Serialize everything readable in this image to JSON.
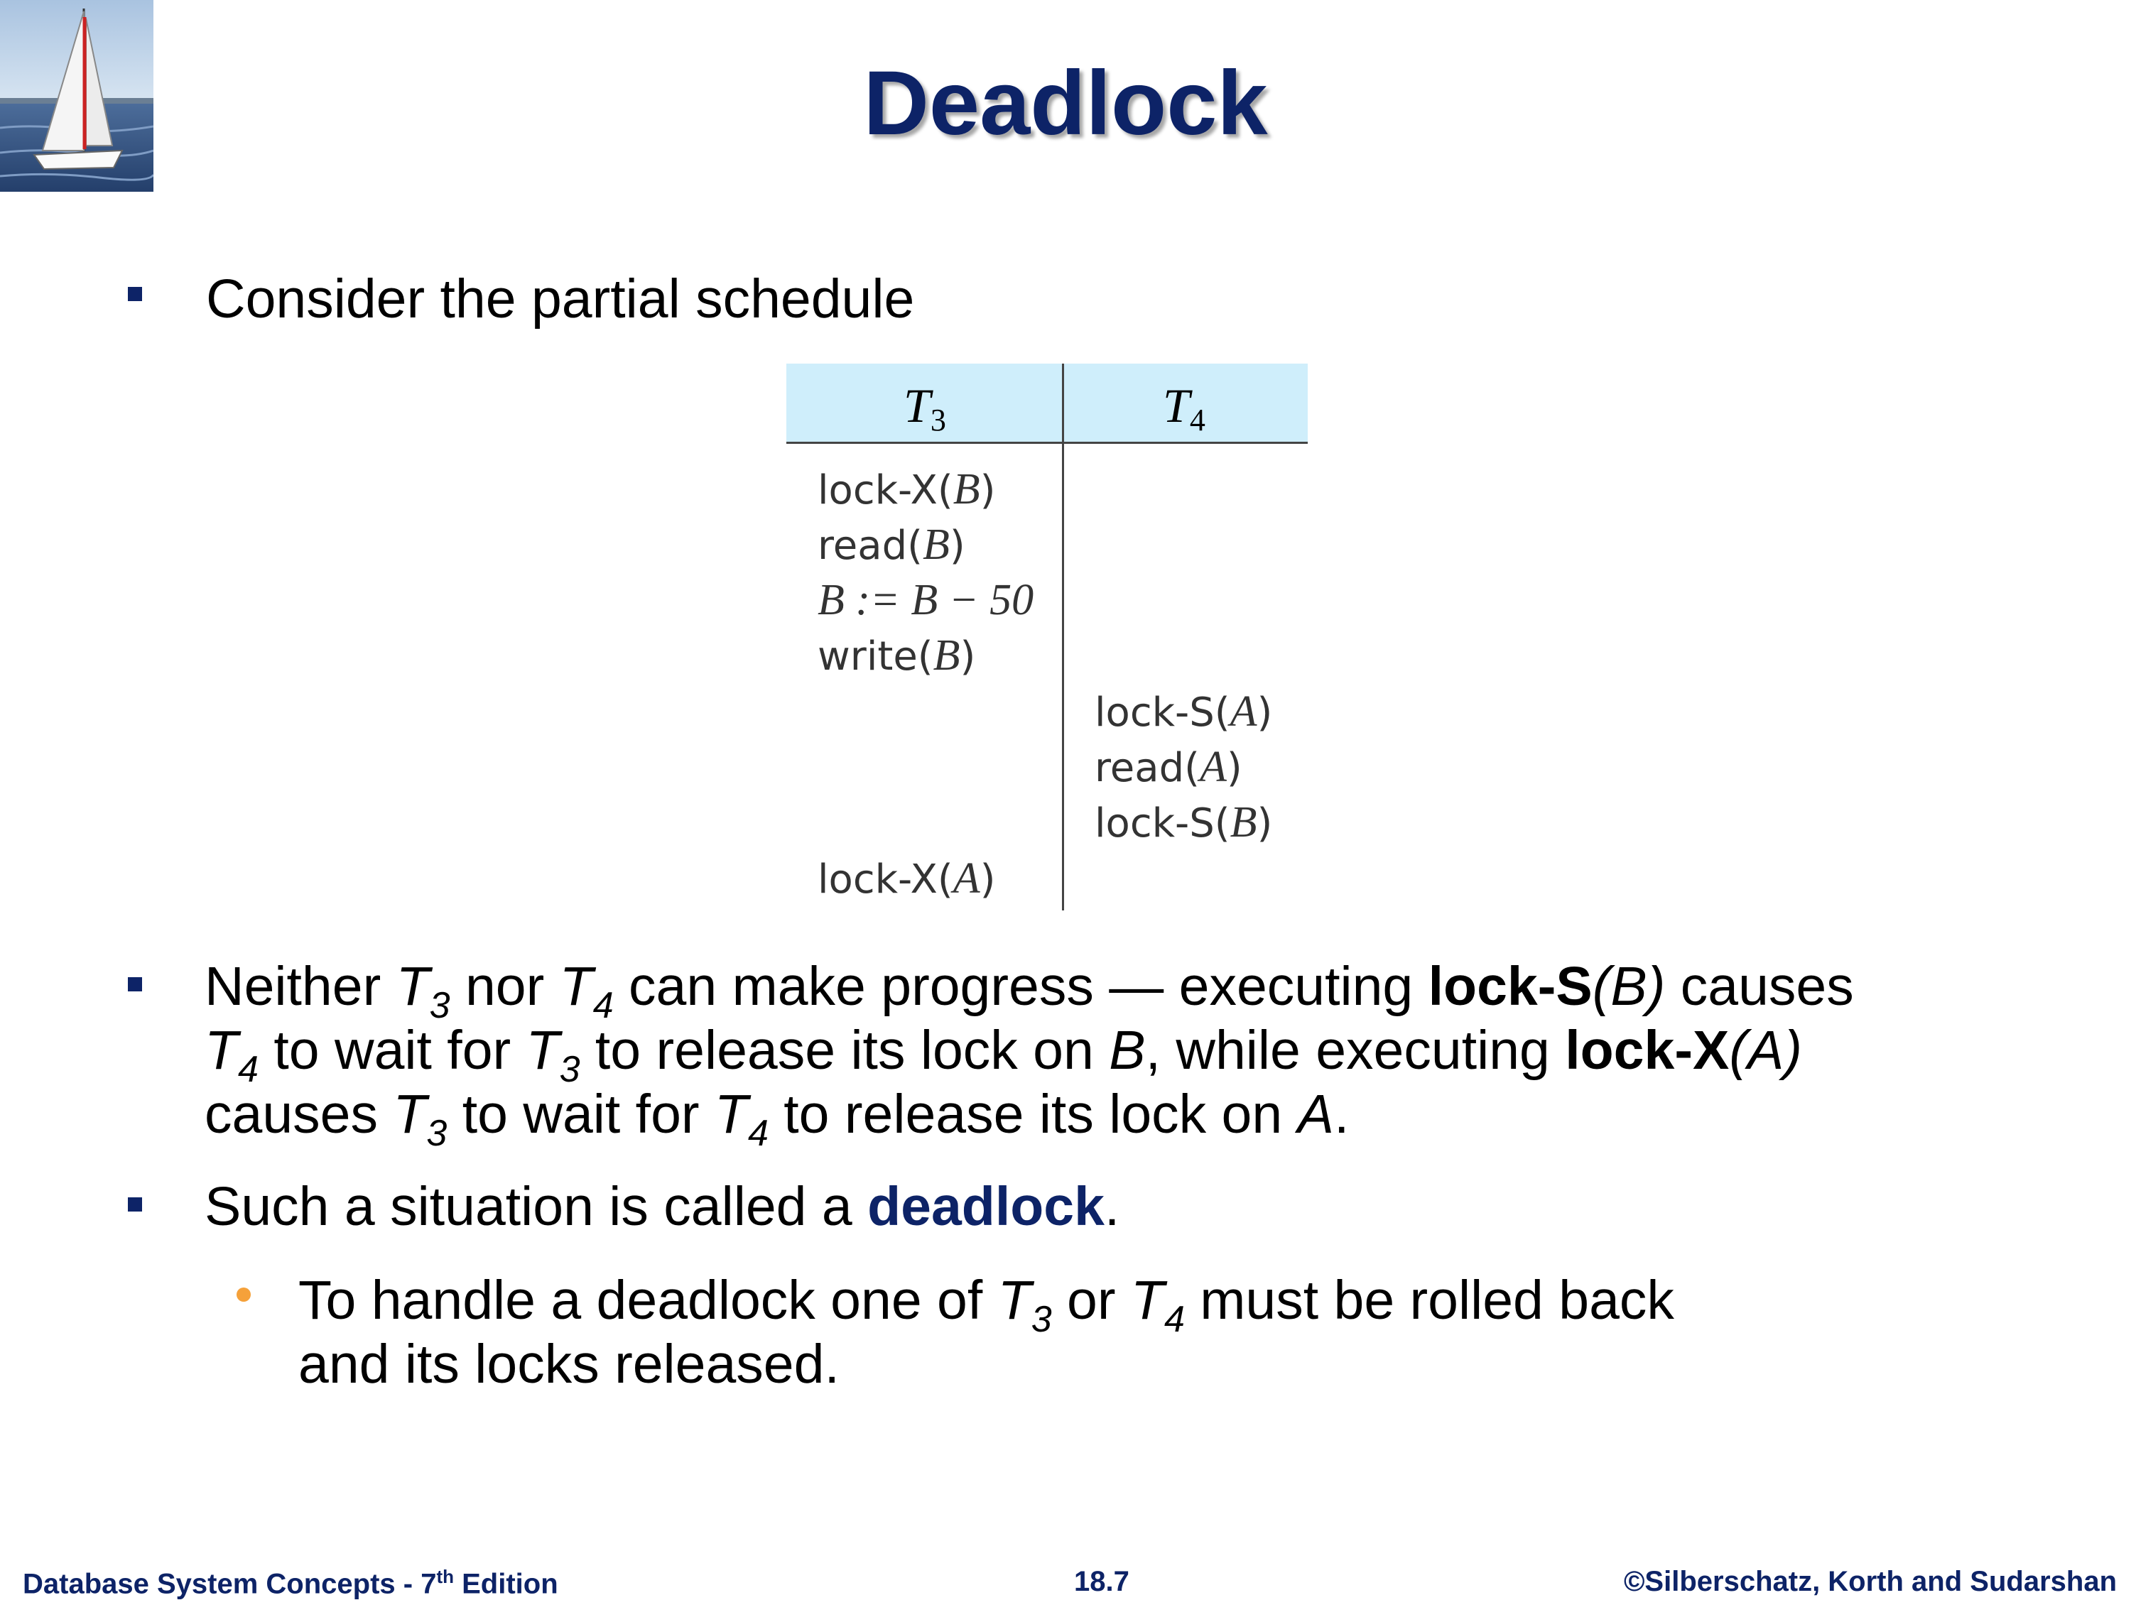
{
  "slide": {
    "title": "Deadlock",
    "bullet1": "Consider the partial schedule",
    "bullet2": {
      "line1_a": "Neither ",
      "T": "T",
      "sub3": "3",
      "sub4": "4",
      "line1_b": " nor ",
      "line1_c": " can make progress — executing ",
      "lockS": "lock-S",
      "argB": "(B)",
      "line1_d": " causes",
      "line2_a": " to wait for ",
      "line2_b": " to release its lock on ",
      "B": "B",
      "line2_c": ", while executing ",
      "lockX": "lock-X",
      "argA": "(A)",
      "line3_a": "causes ",
      "line3_b": "  to wait for ",
      "line3_c": " to release its lock on ",
      "A": "A",
      "dot": "."
    },
    "bullet3": {
      "a": "Such a situation is called a ",
      "term": "deadlock",
      "b": "."
    },
    "sub_bullet": {
      "a": "To handle a deadlock one of ",
      "or": " or ",
      "b": " must be rolled back",
      "line2": "and its locks released."
    }
  },
  "schedule": {
    "headers": [
      {
        "name": "T",
        "sub": "3"
      },
      {
        "name": "T",
        "sub": "4"
      }
    ],
    "t3_ops": [
      {
        "op": "lock-X",
        "arg": "B"
      },
      {
        "op": "read",
        "arg": "B"
      },
      {
        "math": "B := B − 50"
      },
      {
        "op": "write",
        "arg": "B"
      }
    ],
    "t4_ops": [
      {
        "op": "lock-S",
        "arg": "A"
      },
      {
        "op": "read",
        "arg": "A"
      },
      {
        "op": "lock-S",
        "arg": "B"
      }
    ],
    "t3_last": {
      "op": "lock-X",
      "arg": "A"
    }
  },
  "footer": {
    "left": "Database System Concepts - 7",
    "left_sup": "th",
    "left_end": " Edition",
    "center": "18.7",
    "right": "©Silberschatz, Korth and Sudarshan"
  },
  "colors": {
    "title": "#0d2367",
    "bullet": "#0d2367",
    "table_header": "#cfeefb",
    "sub_bullet": "#f5a13a"
  }
}
